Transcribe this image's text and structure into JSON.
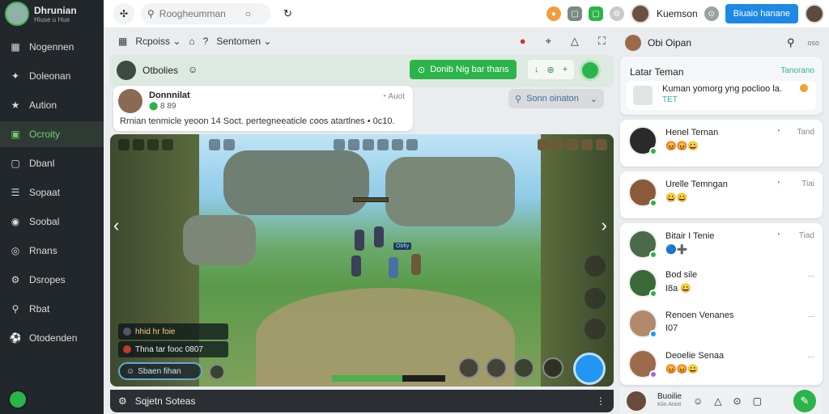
{
  "sidebar": {
    "brand_name": "Dhrunian",
    "brand_sub": "Hiuse u Hue",
    "items": [
      {
        "label": "Nogennen",
        "icon": "grid-icon"
      },
      {
        "label": "Doleonan",
        "icon": "game-icon"
      },
      {
        "label": "Aution",
        "icon": "star-icon"
      },
      {
        "label": "Ocroity",
        "icon": "activity-icon",
        "active": true
      },
      {
        "label": "Dbanl",
        "icon": "chat-icon"
      },
      {
        "label": "Sopaat",
        "icon": "list-icon"
      },
      {
        "label": "Soobal",
        "icon": "globe-icon"
      },
      {
        "label": "Rnans",
        "icon": "target-icon"
      },
      {
        "label": "Dsropes",
        "icon": "gear-icon"
      },
      {
        "label": "Rbat",
        "icon": "search-icon"
      },
      {
        "label": "Otodenden",
        "icon": "soccer-icon"
      }
    ]
  },
  "topbar": {
    "search_placeholder": "Roogheumman",
    "user_name": "Kuemson",
    "primary_button": "Biuaio hanane"
  },
  "subbar": {
    "item1": "Rcpoiss",
    "item2": "Sentomen"
  },
  "header": {
    "title": "Otbolies",
    "green_button": "Donib Nig bar thans"
  },
  "post": {
    "author": "Donnnilat",
    "meta": "8 89",
    "time": "Auot",
    "text": "Rrnian tenmicle yeoon 14 Soct. pertegneeaticle coos atartlnes • 0c10."
  },
  "select": {
    "value": "Sonn oinaton"
  },
  "game": {
    "info1": "hhid hr foie",
    "info2": "Thna tar fooc 0807",
    "pill": "Sbaen fihan",
    "player_tag": "Obfiy",
    "xp_percent": 62
  },
  "footer": {
    "label": "Sqjetn Soteas"
  },
  "right_panel": {
    "head_label": "Obi Oipan",
    "head_meta": "oso",
    "top_card": {
      "title": "Latar Teman",
      "link": "Tanorano",
      "text": "Kuman yomorg yng poclioo la.",
      "sub": "TET"
    },
    "friends": [
      {
        "name": "Henel Ternan",
        "time": "Tand",
        "sub": "😡😡😀"
      },
      {
        "name": "Urelle Temngan",
        "time": "Tiai",
        "sub": "😀😀"
      },
      {
        "name": "Bitair I Tenie",
        "time": "Tiad",
        "sub": "🔵➕"
      },
      {
        "name": "Bod sile",
        "time": "...",
        "sub": "I8a 😀"
      },
      {
        "name": "Renoen Venanes",
        "time": "...",
        "sub": "I07"
      },
      {
        "name": "Deoelie Senaa",
        "time": "...",
        "sub": "😡😡😀"
      }
    ],
    "footer_name": "Buoilie",
    "footer_sub": "Kiio Aniot"
  }
}
